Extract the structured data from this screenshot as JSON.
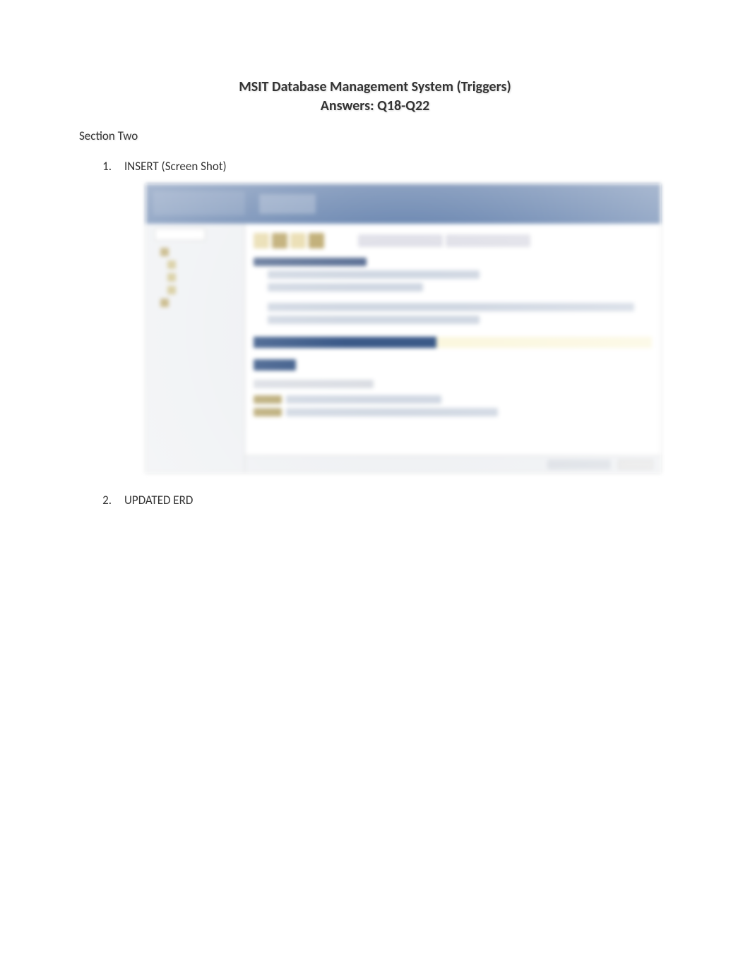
{
  "header": {
    "title_line1": "MSIT Database Management System (Triggers)",
    "title_line2": "Answers: Q18-Q22"
  },
  "section_label": "Section Two",
  "items": [
    {
      "num": "1.",
      "text": "INSERT (Screen Shot)"
    },
    {
      "num": "2.",
      "text": "UPDATED ERD"
    }
  ]
}
